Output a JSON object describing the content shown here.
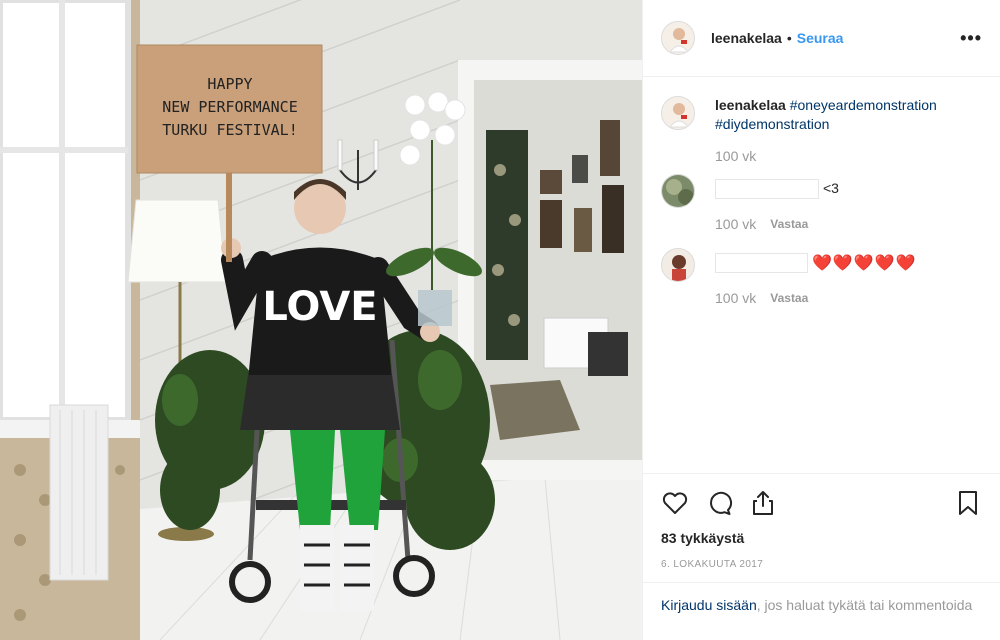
{
  "post": {
    "photo_sign_lines": [
      "HAPPY",
      "NEW PERFORMANCE",
      "TURKU FESTIVAL!"
    ],
    "sweater_text": "LOVE"
  },
  "header": {
    "username": "leenakelaa",
    "separator": "•",
    "follow_label": "Seuraa",
    "more_label": "•••"
  },
  "caption": {
    "username": "leenakelaa",
    "tag1": "#oneyeardemonstration",
    "tag2": "#diydemonstration",
    "time": "100 vk"
  },
  "comments": [
    {
      "text": "<3",
      "time": "100 vk",
      "reply_label": "Vastaa"
    },
    {
      "text": "❤️❤️❤️❤️❤️",
      "time": "100 vk",
      "reply_label": "Vastaa"
    }
  ],
  "actions": {
    "like_icon": "heart-icon",
    "comment_icon": "comment-icon",
    "share_icon": "share-icon",
    "save_icon": "bookmark-icon",
    "likes": "83 tykkäystä",
    "date": "6. LOKAKUUTA 2017"
  },
  "login": {
    "link": "Kirjaudu sisään",
    "rest": ", jos haluat tykätä tai kommentoida"
  },
  "colors": {
    "link_blue": "#3897f0",
    "hashtag": "#003569",
    "muted": "#999999",
    "divider": "#efefef"
  }
}
